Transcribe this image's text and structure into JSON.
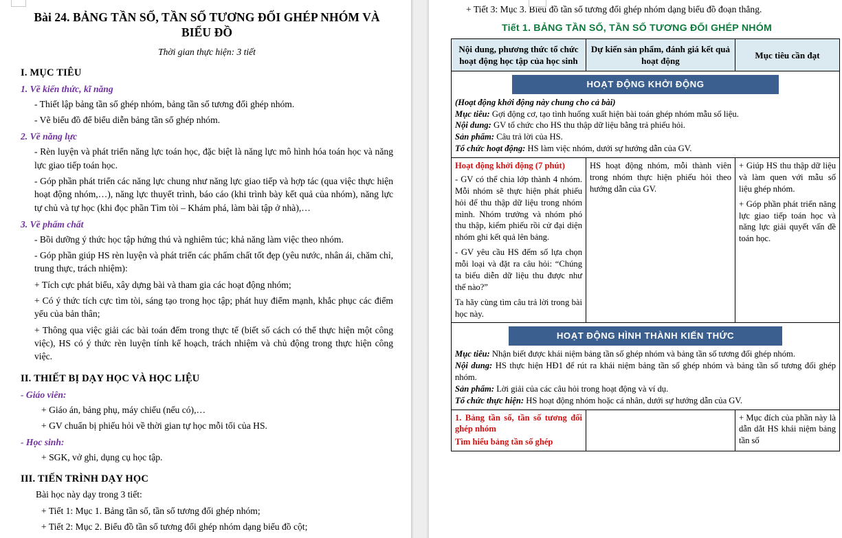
{
  "document": {
    "title": "Bài 24. BẢNG TẦN SỐ, TẦN SỐ TƯƠNG ĐỐI GHÉP NHÓM VÀ BIỂU ĐỒ",
    "subtitle": "Thời gian thực hiện: 3 tiết"
  },
  "left_page": {
    "section_1": {
      "heading": "I. MỤC TIÊU",
      "sub_1": {
        "heading": "1. Về kiến thức, kĩ năng",
        "lines": [
          "- Thiết lập bảng tần số ghép nhóm, bảng tần số tương đối ghép nhóm.",
          "- Vẽ biểu đồ để biểu diễn bảng tần số ghép nhóm."
        ]
      },
      "sub_2": {
        "heading": "2. Về năng lực",
        "lines": [
          "- Rèn luyện và phát triển năng lực toán học, đặc biệt là năng lực mô hình hóa toán học và năng lực giao tiếp toán học.",
          "- Góp phần phát triển các năng lực chung như năng lực giao tiếp và hợp tác (qua việc thực hiện hoạt động nhóm,…), năng lực thuyết trình, báo cáo (khi trình bày kết quả của nhóm), năng lực tự chủ và tự học (khi đọc phần Tìm tòi – Khám phá, làm bài tập ở nhà),…"
        ]
      },
      "sub_3": {
        "heading": "3. Về phẩm chất",
        "lines": [
          "- Bồi dưỡng ý thức học tập hứng thú và nghiêm túc; khả năng làm việc theo nhóm.",
          "- Góp phần giúp HS rèn luyện và phát triển các phẩm chất tốt đẹp (yêu nước, nhân ái, chăm chỉ, trung thực, trách nhiệm):",
          "+ Tích cực phát biểu, xây dựng bài và tham gia các hoạt động nhóm;",
          "+ Có ý thức tích cực tìm tòi, sáng tạo trong học tập; phát huy điểm mạnh, khắc phục các điểm yếu của bản thân;",
          "+ Thông qua việc giải các bài toán đếm trong thực tế (biết số cách có thể thực hiện một công việc), HS có ý thức rèn luyện tính kế hoạch, trách nhiệm và chủ động trong thực hiện công việc."
        ]
      }
    },
    "section_2": {
      "heading": "II. THIẾT BỊ DẠY HỌC VÀ HỌC LIỆU",
      "teacher": {
        "heading": "- Giáo viên:",
        "lines": [
          "+ Giáo án, bảng phụ, máy chiếu (nếu có),…",
          "+ GV chuẩn bị phiếu hỏi về thời gian tự học mỗi tối của HS."
        ]
      },
      "student": {
        "heading": "- Học sinh:",
        "lines": [
          "+ SGK, vở ghi, dụng cụ học tập."
        ]
      }
    },
    "section_3": {
      "heading": "III. TIẾN TRÌNH DẠY HỌC",
      "intro": "Bài học này dạy trong 3 tiết:",
      "lines": [
        "+ Tiết 1: Mục 1. Bảng tần số, tần số tương đối ghép nhóm;",
        "+ Tiết 2: Mục 2. Biểu đồ tần số tương đối ghép nhóm dạng biểu đồ cột;"
      ]
    }
  },
  "right_page": {
    "continuation_line": "+ Tiết 3: Mục 3. Biểu đồ tần số tương đối ghép nhóm dạng biểu đồ đoạn thẳng.",
    "tiet_title": "Tiết 1. BẢNG TẦN SỐ, TẦN SỐ TƯƠNG ĐỐI GHÉP NHÓM",
    "table": {
      "headers": [
        "Nội dung, phương thức tổ chức hoạt động học tập của học sinh",
        "Dự kiến sản phẩm, đánh giá kết quả hoạt động",
        "Mục tiêu cần đạt"
      ],
      "activity_1": {
        "banner": "HOẠT ĐỘNG KHỞI ĐỘNG",
        "note": "(Hoạt động khởi động này chung cho cả bài)",
        "rows": [
          {
            "label": "Mục tiêu:",
            "text": " Gợi động cơ, tạo tình huống xuất hiện bài toán ghép nhóm mẫu số liệu."
          },
          {
            "label": "Nội dung:",
            "text": " GV tổ chức cho HS thu thập dữ liệu bằng trả phiếu hỏi."
          },
          {
            "label": "Sản phẩm:",
            "text": " Câu trả lời của HS."
          },
          {
            "label": "Tổ chức hoạt động:",
            "text": " HS làm việc nhóm, dưới sự hướng dẫn của GV."
          }
        ],
        "body": {
          "col1_title": "Hoạt động khởi động (7 phút)",
          "col1_paras": [
            "- GV có thể chia lớp thành 4 nhóm. Mỗi nhóm sẽ thực hiện phát phiếu hỏi để thu thập dữ liệu trong nhóm mình. Nhóm trưởng và nhóm phó thu thập, kiểm phiếu rồi cử đại diện nhóm ghi kết quả lên bảng.",
            "- GV yêu cầu HS đếm số lựa chọn mỗi loại và đặt ra câu hỏi: “Chúng ta biểu diễn dữ liệu thu được như thế nào?”",
            "Ta hãy cùng tìm câu trả lời trong bài học này."
          ],
          "col2": "HS hoạt động nhóm, mỗi thành viên trong nhóm thực hiện phiếu hỏi theo hướng dẫn của GV.",
          "col3_paras": [
            "+ Giúp HS thu thập dữ liệu và làm quen với mẫu số liệu ghép nhóm.",
            "+ Góp phần phát triển năng lực giao tiếp toán học và năng lực giải quyết vấn đề toán học."
          ]
        }
      },
      "activity_2": {
        "banner": "HOẠT ĐỘNG HÌNH THÀNH KIẾN THỨC",
        "rows": [
          {
            "label": "Mục tiêu:",
            "text": " Nhận biết được khái niệm bảng tần số ghép nhóm và bảng tần số tương đối ghép nhóm."
          },
          {
            "label": "Nội dung:",
            "text": " HS thực hiện HĐ1 để rút ra khái niệm bảng tần số ghép nhóm và bảng tần số tương đối ghép nhóm."
          },
          {
            "label": "Sản phẩm:",
            "text": " Lời giải của các câu hỏi trong hoạt động và ví dụ."
          },
          {
            "label": "Tổ chức thực hiện:",
            "text": " HS hoạt động nhóm hoặc cá nhân, dưới sự hướng dẫn của GV."
          }
        ],
        "body": {
          "col1_title_1": "1. Bảng tần số, tần số tương đối ghép nhóm",
          "col1_title_2": "Tìm hiểu bảng tần số ghép",
          "col2": "",
          "col3": "+ Mục đích của phần này là dẫn dắt HS khái niệm bảng tần số"
        }
      }
    }
  },
  "colors": {
    "purple_heading": "#7030a0",
    "green_title": "#0f7a3d",
    "banner_blue": "#3b5f8f",
    "table_header_bg": "#dbeaf1",
    "red_text": "#d01010"
  }
}
